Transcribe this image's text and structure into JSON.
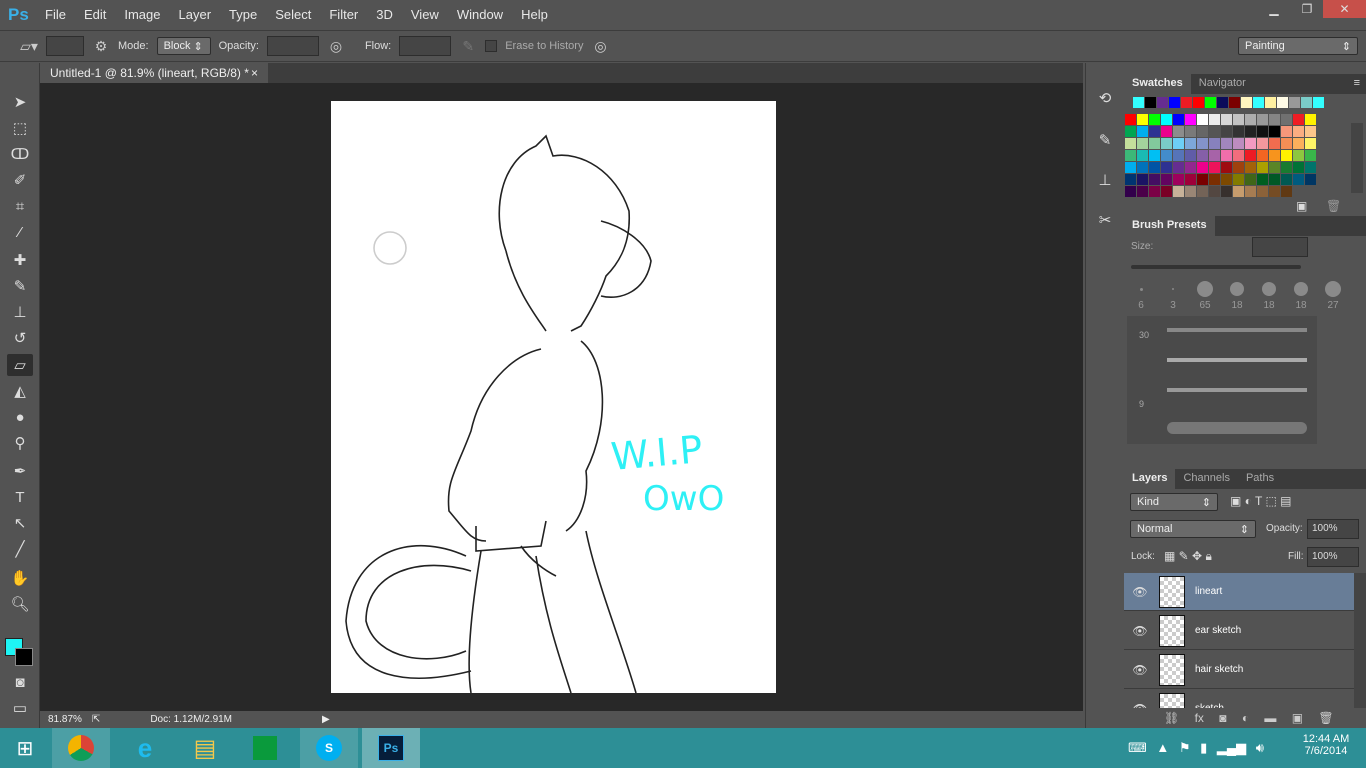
{
  "app": {
    "logo": "Ps",
    "menus": [
      "File",
      "Edit",
      "Image",
      "Layer",
      "Type",
      "Select",
      "Filter",
      "3D",
      "View",
      "Window",
      "Help"
    ],
    "window_controls": [
      "minimize",
      "restore",
      "close"
    ]
  },
  "options": {
    "mode_label": "Mode:",
    "mode_value": "Block",
    "opacity_label": "Opacity:",
    "flow_label": "Flow:",
    "erase_history_label": "Erase to History",
    "workspace": "Painting"
  },
  "document": {
    "tab_title": "Untitled-1 @ 81.9% (lineart, RGB/8) *",
    "close": "×",
    "artwork_text": [
      "W.I.P",
      "OwO"
    ]
  },
  "status": {
    "zoom": "81.87%",
    "doc": "Doc: 1.12M/2.91M"
  },
  "colors": {
    "foreground": "#1ef5f5",
    "background": "#000000",
    "accent_wip": "#2ef0f5"
  },
  "swatches": {
    "tabs": [
      "Swatches",
      "Navigator"
    ],
    "recent": [
      "#3ff",
      "#000",
      "#662d91",
      "#00f",
      "#ed1c24",
      "#f00",
      "#0f0",
      "#0b0b5a",
      "#7b0000",
      "#fff6c0",
      "#3ff",
      "#fff0a0",
      "#fffbe6",
      "#999",
      "#7accc8",
      "#3ff"
    ],
    "grid": [
      [
        "#f00",
        "#ff0",
        "#0f0",
        "#0ff",
        "#00f",
        "#f0f",
        "#fff",
        "#ebebeb",
        "#d6d6d6",
        "#c2c2c2",
        "#adadad",
        "#999",
        "#858585",
        "#707070",
        "#ed1c24",
        "#fff200"
      ],
      [
        "#00a651",
        "#00aeef",
        "#2e3192",
        "#ec008c",
        "#8c8c8c",
        "#7a7a7a",
        "#666",
        "#555",
        "#444",
        "#333",
        "#222",
        "#111",
        "#000",
        "#f7977a",
        "#fbad82",
        "#fdc68a"
      ],
      [
        "#c4df9b",
        "#a3d39c",
        "#82ca9c",
        "#7accc8",
        "#6dcff6",
        "#7da7d9",
        "#8393ca",
        "#8781bd",
        "#a186be",
        "#bd8cbf",
        "#f49ac1",
        "#f5989d",
        "#f26c4f",
        "#f68e55",
        "#fbaf5c",
        "#fff467"
      ],
      [
        "#3cb878",
        "#1abbb4",
        "#00bff3",
        "#438ccb",
        "#5674b9",
        "#605ca8",
        "#855fa8",
        "#a763a8",
        "#f06eaa",
        "#f26d7d",
        "#ed1c24",
        "#f26522",
        "#f7941d",
        "#fff200",
        "#8dc73f",
        "#39b54a"
      ],
      [
        "#00aeef",
        "#0072bc",
        "#0054a6",
        "#2e3192",
        "#662d91",
        "#92278f",
        "#ec008c",
        "#ed145b",
        "#9e0b0f",
        "#a0410d",
        "#a36209",
        "#aba000",
        "#598527",
        "#197b30",
        "#007236",
        "#00746b"
      ],
      [
        "#003471",
        "#1b1464",
        "#440e62",
        "#630460",
        "#9e005d",
        "#9e0039",
        "#790000",
        "#7b2e00",
        "#7d4900",
        "#827b00",
        "#406618",
        "#005e20",
        "#005826",
        "#005952",
        "#005b7f",
        "#003663"
      ],
      [
        "#32004b",
        "#4b0049",
        "#7b0046",
        "#7a0026",
        "#c7b299",
        "#998675",
        "#736357",
        "#534741",
        "#37302d",
        "#c69c6d",
        "#a67c52",
        "#8c6239",
        "#754c24",
        "#603913",
        "",
        ""
      ]
    ]
  },
  "brush_presets": {
    "title": "Brush Presets",
    "size_label": "Size:",
    "tips": [
      "6",
      "3",
      "65",
      "18",
      "18",
      "18",
      "27"
    ],
    "strokes": [
      "30",
      "",
      "9",
      ""
    ]
  },
  "layers": {
    "tabs": [
      "Layers",
      "Channels",
      "Paths"
    ],
    "kind": "Kind",
    "blend": "Normal",
    "opacity_label": "Opacity:",
    "opacity": "100%",
    "lock_label": "Lock:",
    "fill_label": "Fill:",
    "fill": "100%",
    "items": [
      {
        "name": "lineart",
        "selected": true
      },
      {
        "name": "ear sketch",
        "selected": false
      },
      {
        "name": "hair sketch",
        "selected": false
      },
      {
        "name": "sketch",
        "selected": false
      }
    ]
  },
  "taskbar": {
    "apps": [
      "Chrome",
      "Internet Explorer",
      "File Explorer",
      "Store",
      "Skype",
      "Photoshop"
    ],
    "time": "12:44 AM",
    "date": "7/6/2014"
  }
}
